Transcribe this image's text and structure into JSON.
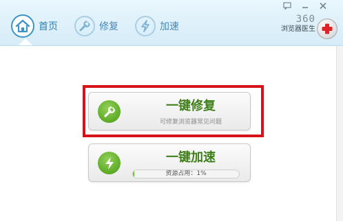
{
  "tabs": [
    {
      "label": "首页",
      "icon": "home-icon",
      "active": true
    },
    {
      "label": "修复",
      "icon": "wrench-icon",
      "active": false
    },
    {
      "label": "加速",
      "icon": "lightning-icon",
      "active": false
    }
  ],
  "window_controls": [
    "feedback-icon",
    "minimize-icon",
    "close-icon"
  ],
  "brand": {
    "number": "360",
    "name": "浏览器医生",
    "logo": "red-cross-icon"
  },
  "actions": {
    "repair": {
      "title": "一键修复",
      "subtitle": "可修复浏览器常见问题",
      "icon": "wrench-icon"
    },
    "speed": {
      "title": "一键加速",
      "usage_label": "资源占用：1%",
      "usage_percent": 1,
      "icon": "lightning-icon"
    }
  },
  "colors": {
    "accent_blue": "#3b93c8",
    "action_green": "#5aa823",
    "title_green": "#3f7f19",
    "highlight_red": "#d4131b",
    "logo_red": "#e02127"
  }
}
